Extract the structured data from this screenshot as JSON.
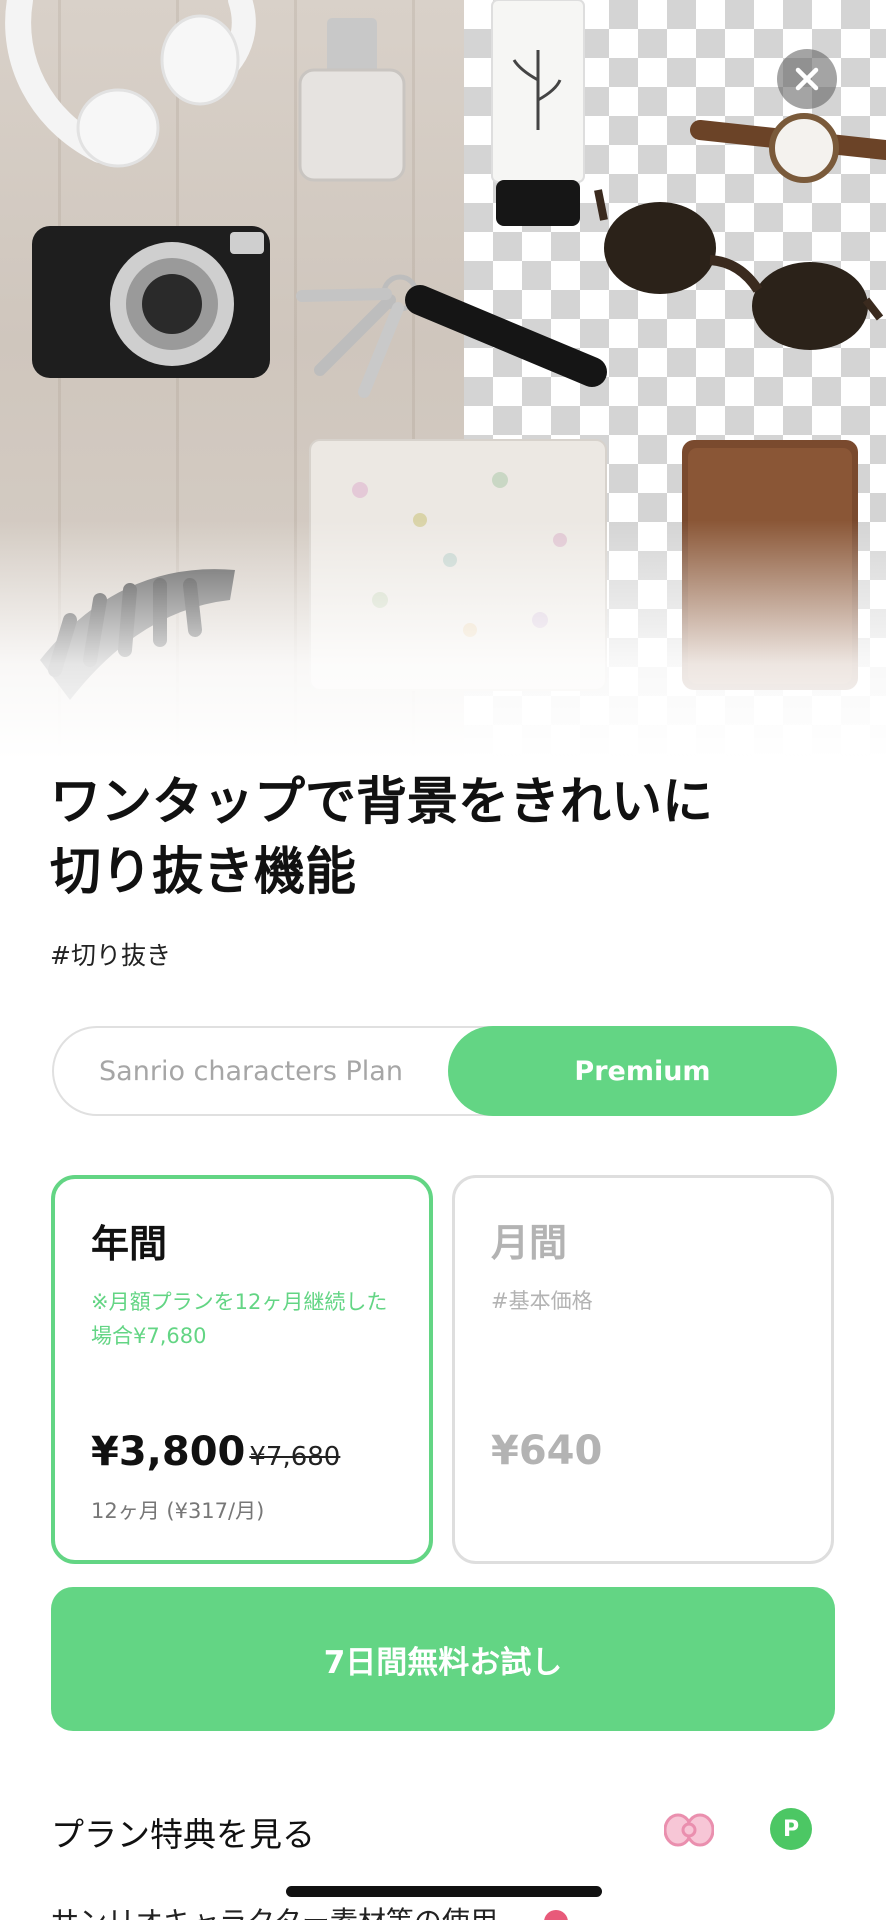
{
  "close": {
    "label": "×"
  },
  "headline": {
    "line1": "ワンタップで背景をきれいに",
    "line2": "切り抜き機能"
  },
  "tag": "#切り抜き",
  "plans": {
    "sanrio": "Sanrio characters Plan",
    "premium": "Premium",
    "selected": "Premium"
  },
  "cards": {
    "annual": {
      "title": "年間",
      "note": "※月額プランを12ヶ月継続した場合¥7,680",
      "price": "¥3,800",
      "old_price": "¥7,680",
      "sub": "12ヶ月 (¥317/月)"
    },
    "monthly": {
      "title": "月間",
      "note": "#基本価格",
      "price": "¥640"
    }
  },
  "trial_button": "7日間無料お試し",
  "benefits": {
    "title": "プラン特典を見る",
    "p_badge": "P"
  },
  "next_item": "サンリオキャラクター素材等の使用",
  "colors": {
    "accent": "#63d584",
    "muted": "#b3b3b3",
    "close_bg": "#5a5a5a"
  }
}
